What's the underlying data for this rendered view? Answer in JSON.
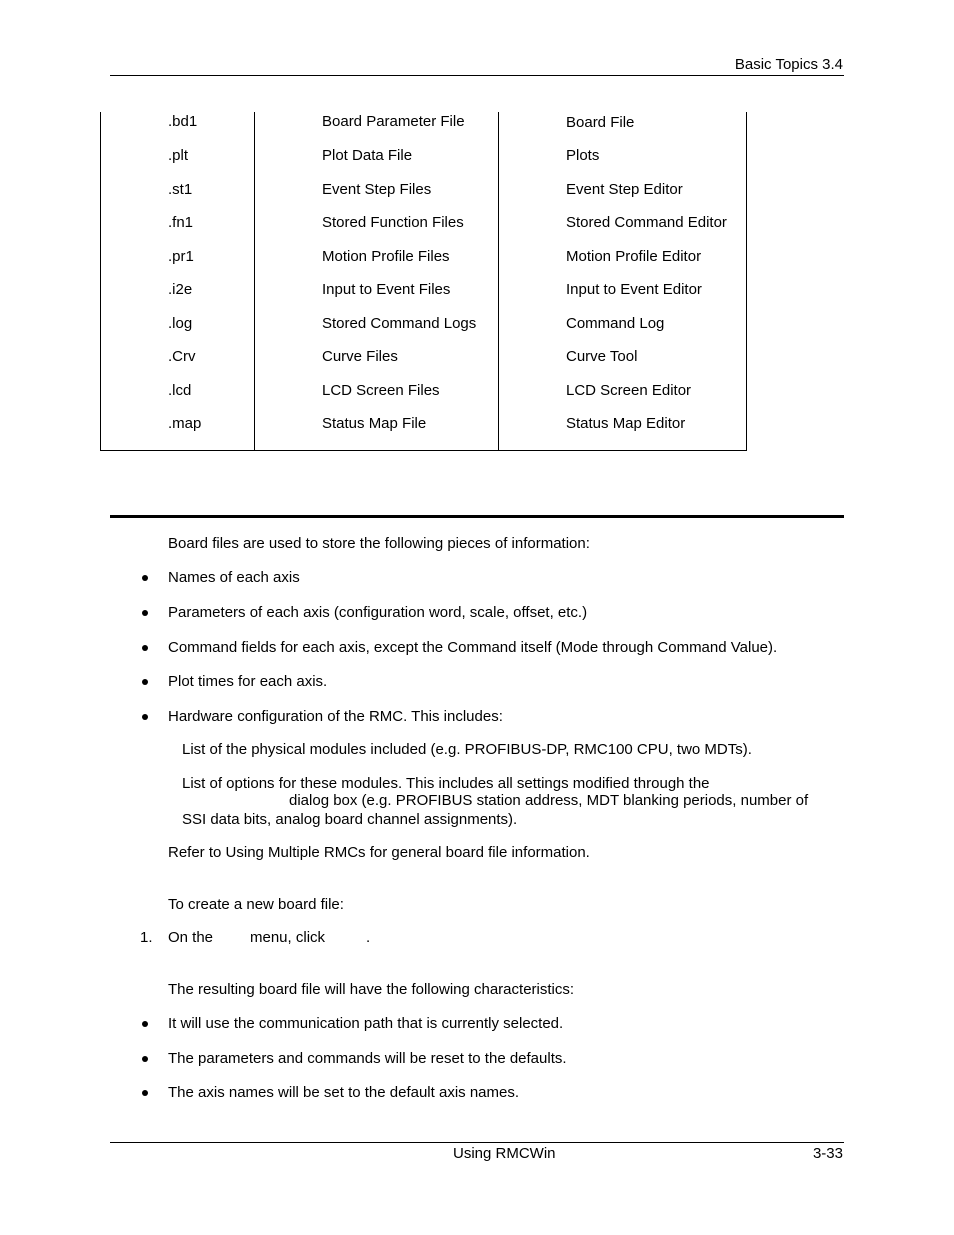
{
  "header": {
    "section": "Basic Topics  3.4"
  },
  "file_table": {
    "rows": [
      {
        "extension": ".bd1",
        "description": "Board Parameter File",
        "tool": "Board File"
      },
      {
        "extension": ".plt",
        "description": "Plot Data File",
        "tool": "Plots"
      },
      {
        "extension": ".st1",
        "description": "Event Step Files",
        "tool": "Event Step Editor"
      },
      {
        "extension": ".fn1",
        "description": "Stored Function Files",
        "tool": "Stored Command Editor"
      },
      {
        "extension": ".pr1",
        "description": "Motion Profile Files",
        "tool": "Motion Profile Editor"
      },
      {
        "extension": ".i2e",
        "description": "Input to Event Files",
        "tool": "Input to Event Editor"
      },
      {
        "extension": ".log",
        "description": "Stored Command Logs",
        "tool": "Command Log"
      },
      {
        "extension": ".Crv",
        "description": "Curve Files",
        "tool": "Curve Tool"
      },
      {
        "extension": ".lcd",
        "description": "LCD Screen Files",
        "tool": "LCD Screen Editor"
      },
      {
        "extension": ".map",
        "description": "Status Map File",
        "tool": "Status Map Editor"
      }
    ]
  },
  "board_files": {
    "intro": "Board files are used to store the following pieces of information:",
    "bullets": [
      "Names of each axis",
      "Parameters of each axis (configuration word, scale, offset, etc.)",
      "Command fields for each axis, except the Command itself (Mode through Command Value).",
      "Plot times for each axis.",
      "Hardware configuration of the RMC. This includes:"
    ],
    "sub_items": {
      "modules": "List of the physical modules included (e.g. PROFIBUS-DP, RMC100 CPU, two MDTs).",
      "options_line1": "List of options for these modules. This includes all settings modified through the",
      "options_line2": "dialog box (e.g. PROFIBUS station address, MDT blanking periods, number of",
      "options_line3": "SSI data bits, analog board channel assignments)."
    },
    "refer": "Refer to Using Multiple RMCs for general board file information."
  },
  "create_procedure": {
    "intro": "To create a new board file:",
    "step_number": "1.",
    "step_part1": "On the",
    "step_part2": "menu, click",
    "step_part3": ".",
    "result_intro": "The resulting board file will have the following characteristics:",
    "characteristics": [
      "It will use the communication path that is currently selected.",
      "The parameters and commands will be reset to the defaults.",
      "The axis names will be set to the default axis names."
    ]
  },
  "footer": {
    "title": "Using RMCWin",
    "page": "3-33"
  }
}
